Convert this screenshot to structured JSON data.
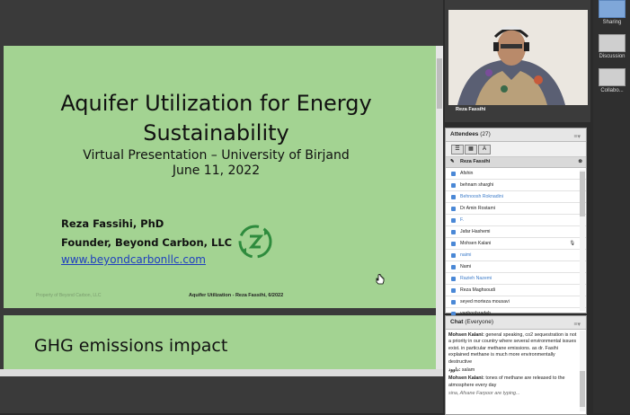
{
  "slide1": {
    "title_line1": "Aquifer Utilization for Energy",
    "title_line2": "Sustainability",
    "subtitle": "Virtual Presentation – University of Birjand",
    "date": "June 11, 2022",
    "author_name": "Reza Fassihi, PhD",
    "author_role": "Founder, Beyond Carbon, LLC",
    "website": "www.beyondcarbonllc.com",
    "footer_left": "Property of Beyond Carbon, LLC",
    "footer_center": "Aquifer Utilization - Reza Fassihi, 6/2022"
  },
  "slide2": {
    "title": "GHG emissions impact"
  },
  "video": {
    "name": "Reza Fassihi"
  },
  "sidebar": {
    "items": [
      {
        "label": "Sharing"
      },
      {
        "label": "Discussion"
      },
      {
        "label": "Collabo..."
      }
    ]
  },
  "attendees": {
    "title": "Attendees",
    "count": "(27)",
    "host": "Reza Fassihi",
    "list": [
      "Afshin",
      "behnam sharghi",
      "Behnoosh Roknadini",
      "Dr Amin Rostami",
      "F.",
      "Jafar Hashemi",
      "Mohsen Kalani",
      "naimi",
      "Nami",
      "Razieh Nazemi",
      "Reza Maghsoudi",
      "seyed morteza mousavi",
      "yaghoobzadeh"
    ]
  },
  "chat": {
    "title": "Chat",
    "scope": "(Everyone)",
    "messages": [
      {
        "sender": "Mohsen Kalani:",
        "text": "general speaking, co2 sequestration is not a priority in our country where several environmental issues exist. in particular methane emissions. as dr. Fasihi explained methane is much more environmentally destructive"
      },
      {
        "sender": "داوود:",
        "text": "salam"
      },
      {
        "sender": "Mohsen Kalani:",
        "text": "tones of methane are released to the atmosphere every day"
      }
    ],
    "typing": "sina, Afsane Farpoor are typing..."
  },
  "colors": {
    "slide_bg": "#a3d392",
    "link": "#1f3fbf",
    "accent_blue": "#3d7cc9",
    "logo_green": "#2e8b3d"
  }
}
